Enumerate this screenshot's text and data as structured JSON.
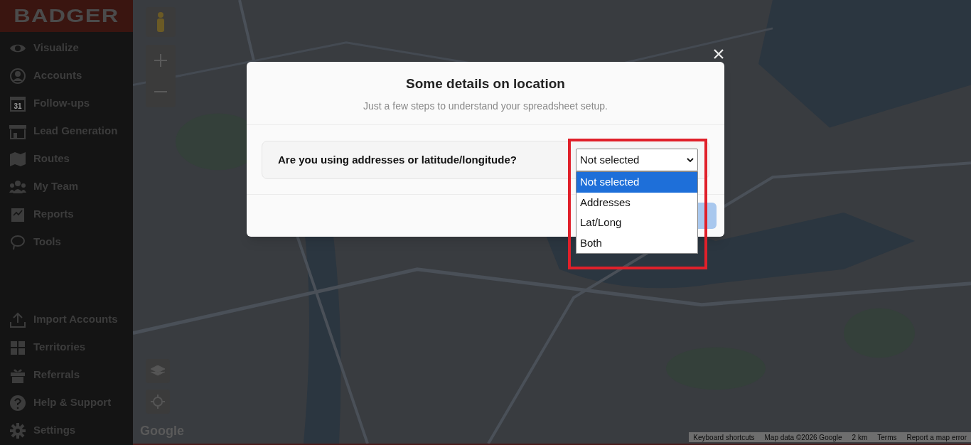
{
  "sidebar": {
    "logo": "BADGER",
    "items": [
      {
        "label": "Visualize"
      },
      {
        "label": "Accounts"
      },
      {
        "label": "Follow-ups",
        "icon_text": "31"
      },
      {
        "label": "Lead Generation"
      },
      {
        "label": "Routes"
      },
      {
        "label": "My Team"
      },
      {
        "label": "Reports"
      },
      {
        "label": "Tools"
      }
    ],
    "bottom_items": [
      {
        "label": "Import Accounts"
      },
      {
        "label": "Territories"
      },
      {
        "label": "Referrals"
      },
      {
        "label": "Help & Support"
      },
      {
        "label": "Settings"
      }
    ]
  },
  "map": {
    "logo": "Google",
    "attribution": [
      "Keyboard shortcuts",
      "Map data ©2026 Google",
      "2 km",
      "Terms",
      "Report a map error"
    ]
  },
  "dialog": {
    "title": "Some details on location",
    "subtitle": "Just a few steps to understand your spreadsheet setup.",
    "question": "Are you using addresses or latitude/longitude?",
    "select": {
      "value": "Not selected",
      "expanded": true,
      "highlighted": true,
      "options": [
        {
          "label": "Not selected",
          "selected": true
        },
        {
          "label": "Addresses",
          "selected": false
        },
        {
          "label": "Lat/Long",
          "selected": false
        },
        {
          "label": "Both",
          "selected": false
        }
      ]
    }
  }
}
